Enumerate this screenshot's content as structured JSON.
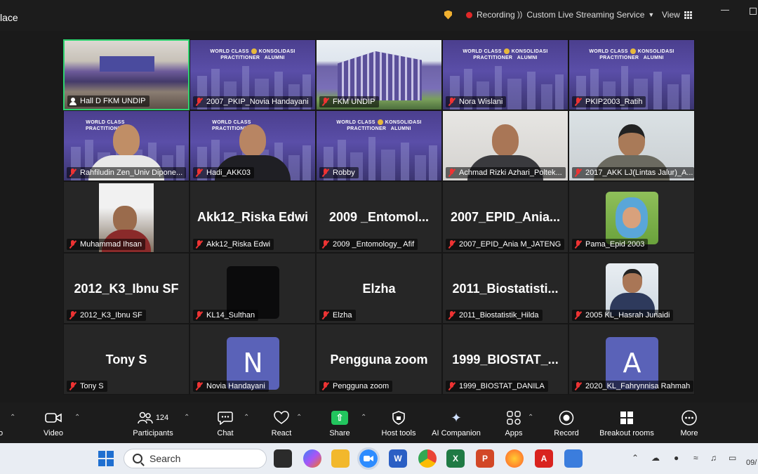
{
  "window": {
    "title_fragment": "lace"
  },
  "topbar": {
    "recording_label": "Recording",
    "streaming_label": "Custom Live Streaming Service",
    "view_label": "View"
  },
  "banner": {
    "line1": "WORLD CLASS",
    "line2": "PRACTITIONER",
    "line3": "KONSOLIDASI",
    "line4": "ALUMNI"
  },
  "participants": [
    {
      "name": "Hall D FKM UNDIP",
      "kind": "room-video",
      "muted": false,
      "active": true
    },
    {
      "name": "2007_PKIP_Novia Handayani",
      "kind": "banner",
      "muted": true
    },
    {
      "name": "FKM UNDIP",
      "kind": "building",
      "muted": true
    },
    {
      "name": "Nora Wislani",
      "kind": "banner",
      "muted": true
    },
    {
      "name": "PKIP2003_Ratih",
      "kind": "banner",
      "muted": true
    },
    {
      "name": "Rahfiludin Zen_Univ Dipone...",
      "kind": "banner-person",
      "muted": true
    },
    {
      "name": "Hadi_AKK03",
      "kind": "banner-person",
      "muted": true
    },
    {
      "name": "Robby",
      "kind": "banner",
      "muted": true
    },
    {
      "name": "Achmad Rizki Azhari_Poltek...",
      "kind": "camera",
      "muted": true
    },
    {
      "name": "2017_AKK LJ(Lintas Jalur)_A...",
      "kind": "camera",
      "muted": true
    },
    {
      "name": "Muhammad Ihsan",
      "kind": "camera-small",
      "muted": true
    },
    {
      "name": "Akk12_Riska Edwi",
      "big": "Akk12_Riska Edwi",
      "kind": "name",
      "muted": true
    },
    {
      "name": "2009 _Entomology_ Afif",
      "big": "2009 _Entomol...",
      "kind": "name",
      "muted": true
    },
    {
      "name": "2007_EPID_Ania M_JATENG",
      "big": "2007_EPID_Ania...",
      "kind": "name",
      "muted": true
    },
    {
      "name": "Pama_Epid 2003",
      "kind": "avatar-photo",
      "muted": true
    },
    {
      "name": "2012_K3_Ibnu SF",
      "big": "2012_K3_Ibnu SF",
      "kind": "name",
      "muted": true
    },
    {
      "name": "KL14_Sulthan",
      "kind": "avatar-dark",
      "muted": true
    },
    {
      "name": "Elzha",
      "big": "Elzha",
      "kind": "name",
      "muted": true
    },
    {
      "name": "2011_Biostatistik_Hilda",
      "big": "2011_Biostatisti...",
      "kind": "name",
      "muted": true
    },
    {
      "name": "2005 KL_Hasrah Junaidi",
      "kind": "avatar-photo2",
      "muted": true
    },
    {
      "name": "Tony S",
      "big": "Tony S",
      "kind": "name",
      "muted": true
    },
    {
      "name": "Novia Handayani",
      "letter": "N",
      "kind": "avatar-letter",
      "muted": true
    },
    {
      "name": "Pengguna zoom",
      "big": "Pengguna zoom",
      "kind": "name",
      "muted": true
    },
    {
      "name": "1999_BIOSTAT_DANILA",
      "big": "1999_BIOSTAT_...",
      "kind": "name",
      "muted": true
    },
    {
      "name": "2020_KL_Fahrynnisa Rahmah",
      "letter": "A",
      "kind": "avatar-letter",
      "muted": true
    }
  ],
  "toolbar": {
    "audio_label": "o",
    "video_label": "Video",
    "participants_label": "Participants",
    "participants_count": "124",
    "chat_label": "Chat",
    "react_label": "React",
    "share_label": "Share",
    "host_tools_label": "Host tools",
    "ai_companion_label": "AI Companion",
    "apps_label": "Apps",
    "record_label": "Record",
    "breakout_label": "Breakout rooms",
    "more_label": "More"
  },
  "taskbar": {
    "search_placeholder": "Search",
    "clock_fragment": "09/"
  }
}
